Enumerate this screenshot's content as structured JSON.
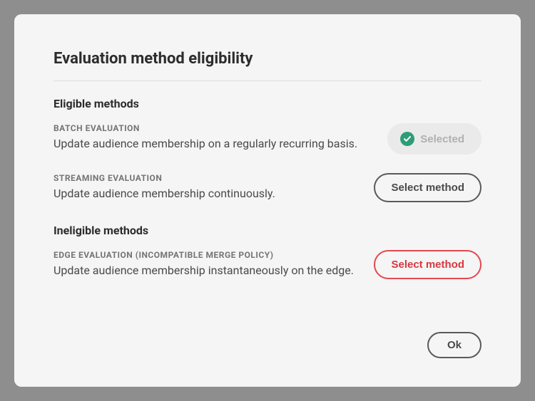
{
  "modal": {
    "title": "Evaluation method eligibility",
    "ok_label": "Ok"
  },
  "eligible": {
    "heading": "Eligible methods",
    "methods": [
      {
        "label": "BATCH EVALUATION",
        "description": "Update audience membership on a regularly recurring basis.",
        "button_label": "Selected",
        "state": "selected"
      },
      {
        "label": "STREAMING EVALUATION",
        "description": "Update audience membership continuously.",
        "button_label": "Select method",
        "state": "selectable"
      }
    ]
  },
  "ineligible": {
    "heading": "Ineligible methods",
    "methods": [
      {
        "label": "EDGE EVALUATION (INCOMPATIBLE MERGE POLICY)",
        "description": "Update audience membership instantaneously on the edge.",
        "button_label": "Select method",
        "state": "danger"
      }
    ]
  }
}
